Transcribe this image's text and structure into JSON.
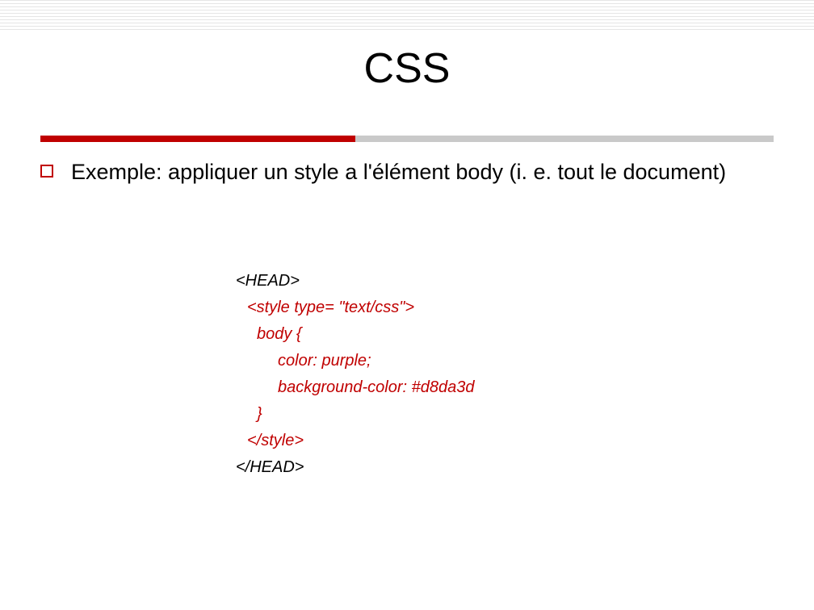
{
  "title": "CSS",
  "bullet": "Exemple: appliquer un style a l'élément body (i. e. tout le document)",
  "code": {
    "l1": "<HEAD>",
    "l2": "<style type= \"text/css\">",
    "l3": "body {",
    "l4": "color: purple;",
    "l5": "background-color: #d8da3d",
    "l6": "}",
    "l7": "</style>",
    "l8": "</HEAD>"
  }
}
